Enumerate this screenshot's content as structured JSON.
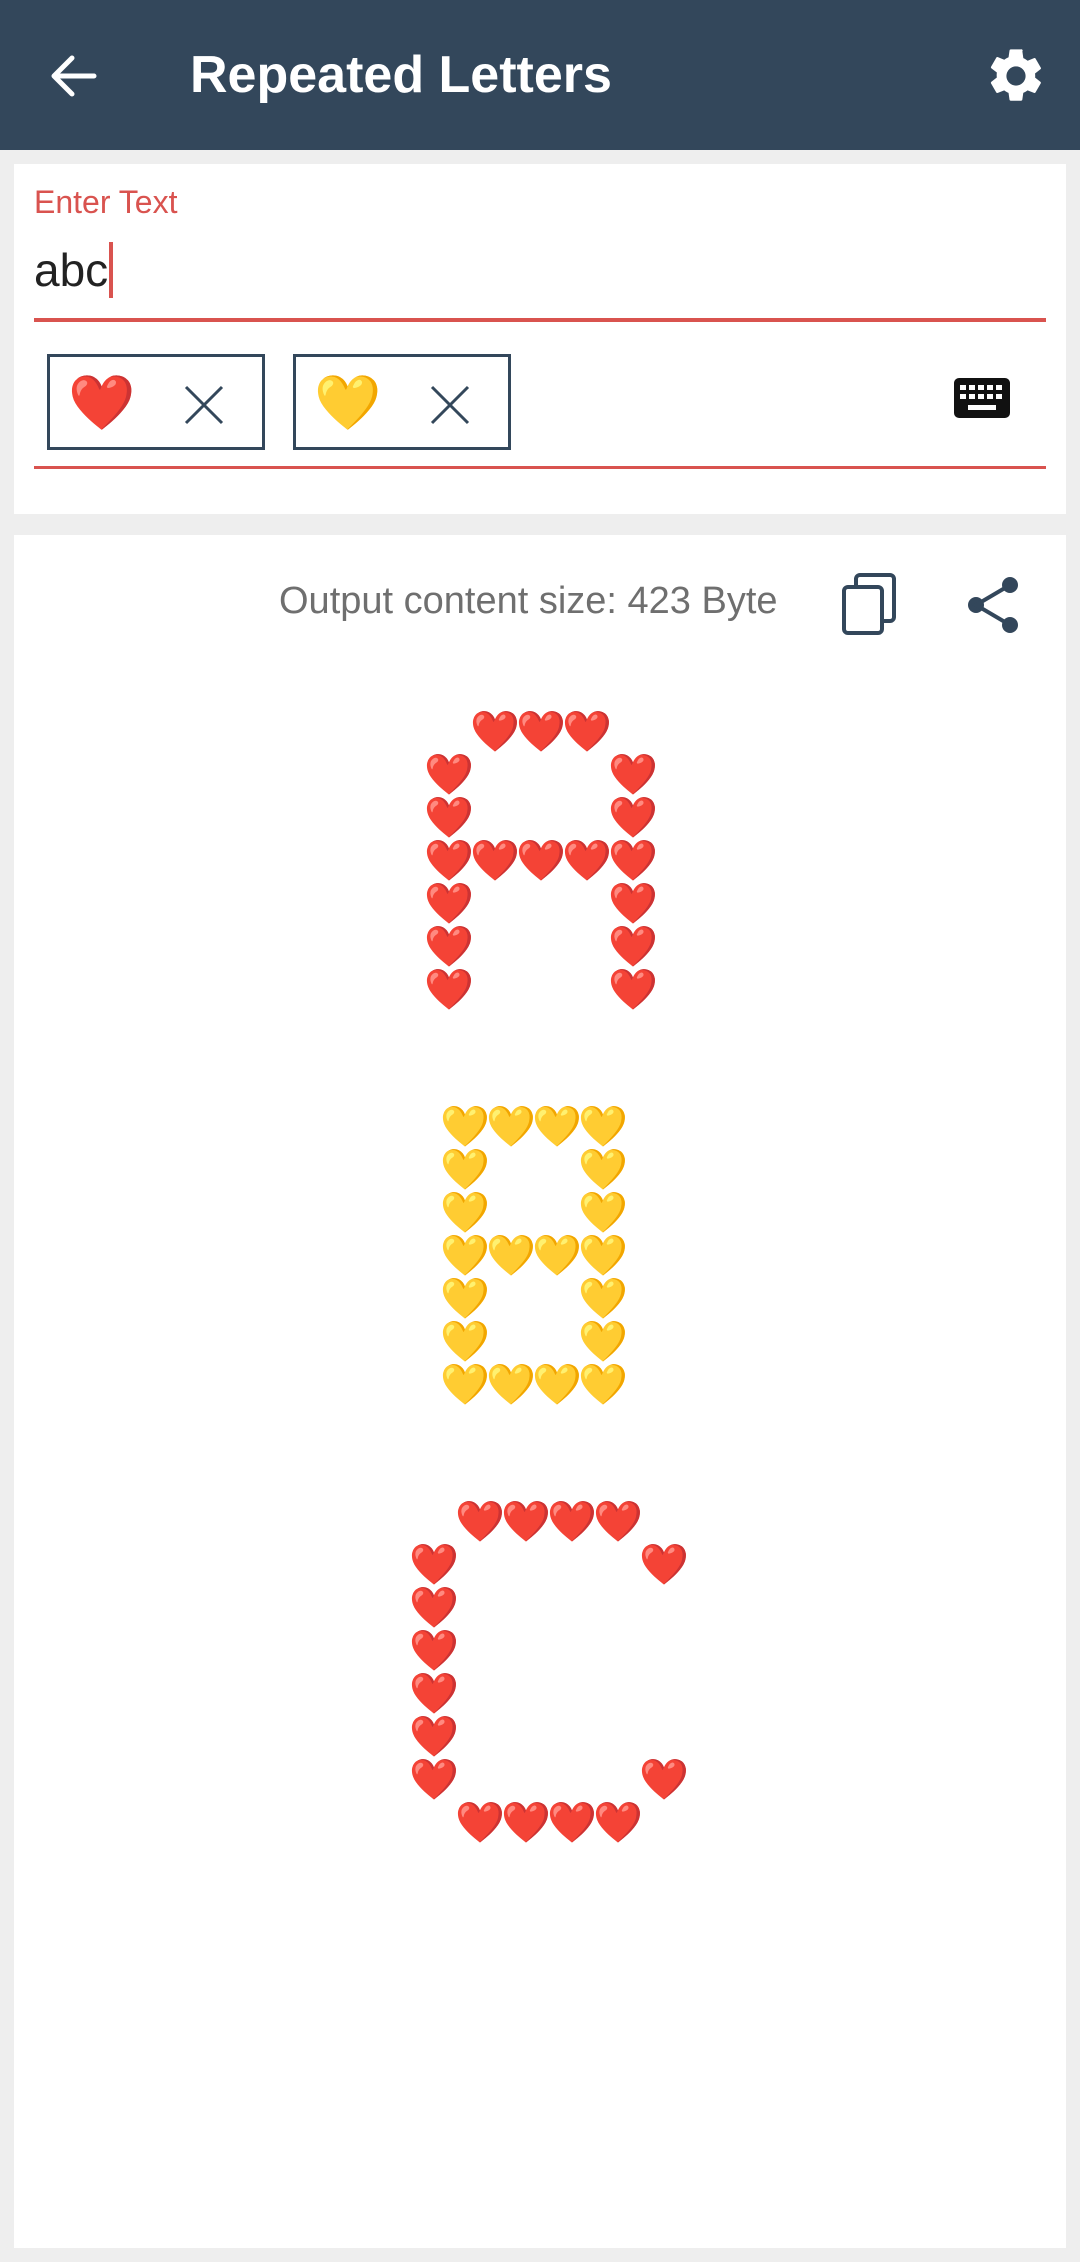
{
  "app_bar": {
    "title": "Repeated Letters",
    "back_icon": "arrow-left-icon",
    "settings_icon": "gear-icon"
  },
  "input": {
    "label": "Enter Text",
    "value": "abc",
    "accent_color": "#d9534f"
  },
  "emoji_chips": [
    {
      "emoji": "❤️",
      "remove_icon": "close-icon"
    },
    {
      "emoji": "💛",
      "remove_icon": "close-icon"
    }
  ],
  "keyboard_icon": "keyboard-icon",
  "output": {
    "size_text": "Output content size: 423 Byte",
    "copy_icon": "copy-icon",
    "share_icon": "share-icon",
    "letters": [
      {
        "letter": "A",
        "emoji": "❤️",
        "rows": [
          " ooo ",
          "o   o",
          "o   o",
          "ooooo",
          "o   o",
          "o   o",
          "o   o"
        ]
      },
      {
        "letter": "B",
        "emoji": "💛",
        "rows": [
          "oooo",
          "o  o",
          "o  o",
          "oooo",
          "o  o",
          "o  o",
          "oooo"
        ]
      },
      {
        "letter": "C",
        "emoji": "❤️",
        "rows": [
          " oooo ",
          "o    o",
          "o     ",
          "o     ",
          "o     ",
          "o     ",
          "o    o",
          " oooo "
        ]
      }
    ]
  },
  "colors": {
    "app_bar": "#33475b",
    "accent": "#d9534f"
  }
}
